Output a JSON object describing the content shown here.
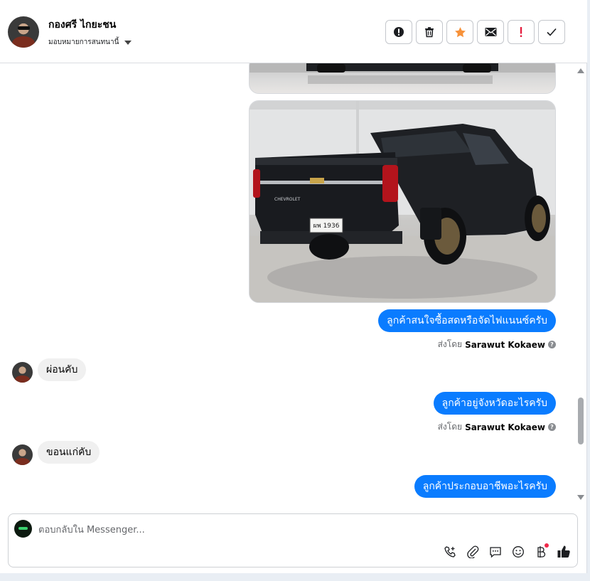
{
  "header": {
    "contact_name": "กองศรี ไกยะชน",
    "assign_label": "มอบหมายการสนทนานี้",
    "actions": [
      {
        "name": "spam-button",
        "icon": "alert-circle-icon"
      },
      {
        "name": "delete-button",
        "icon": "trash-icon"
      },
      {
        "name": "star-button",
        "icon": "star-icon",
        "color": "#f7923a"
      },
      {
        "name": "email-button",
        "icon": "envelope-icon"
      },
      {
        "name": "follow-up-button",
        "icon": "exclamation-icon",
        "color": "#e41e3f"
      },
      {
        "name": "done-button",
        "icon": "check-icon"
      }
    ]
  },
  "messages": {
    "m1": "ลูกค้าสนใจซื้อสดหรือจัดไฟแนนซ์ครับ",
    "sent_prefix": "ส่งโดย",
    "sent_by": "Sarawut Kokaew",
    "r1": "ผ่อนคับ",
    "m2": "ลูกค้าอยู่จังหวัดอะไรครับ",
    "r2": "ขอนแก่คับ",
    "m3": "ลูกค้าประกอบอาชีพอะไรครับ",
    "truck_plate": "ผพ 1936",
    "truck_brand": "CHEVROLET"
  },
  "composer": {
    "placeholder": "ตอบกลับใน Messenger..."
  },
  "colors": {
    "outgoing_bubble": "#0a7cff",
    "incoming_bubble": "#f0f0f0",
    "like": "#1c1e21"
  }
}
